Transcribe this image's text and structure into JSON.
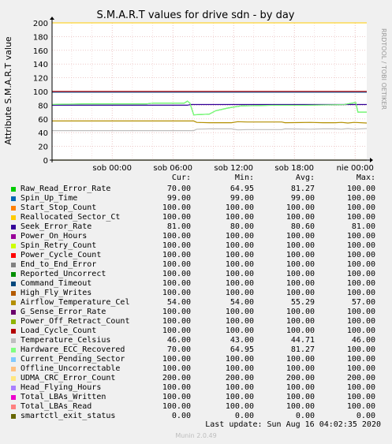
{
  "chart_data": {
    "type": "line",
    "title": "S.M.A.R.T values for drive sdn - by day",
    "ylabel": "Attribute S.M.A.R.T value",
    "side_label": "RRDTOOL / TOBI OETIKER",
    "ylim": [
      0,
      200
    ],
    "y_ticks": [
      "0",
      "20",
      "40",
      "60",
      "80",
      "100",
      "120",
      "140",
      "160",
      "180",
      "200"
    ],
    "x_ticks": [
      {
        "label": "sob 00:00",
        "t": 0.191
      },
      {
        "label": "sob 06:00",
        "t": 0.384
      },
      {
        "label": "sob 12:00",
        "t": 0.577
      },
      {
        "label": "sob 18:00",
        "t": 0.77
      },
      {
        "label": "nie 00:00",
        "t": 0.963
      }
    ],
    "columns": [
      "Cur:",
      "Min:",
      "Avg:",
      "Max:"
    ],
    "series": [
      {
        "name": "Raw_Read_Error_Rate",
        "color": "#00cc00",
        "cur": "70.00",
        "min": "64.95",
        "avg": "81.27",
        "max": "100.00"
      },
      {
        "name": "Spin_Up_Time",
        "color": "#0066b3",
        "cur": "99.00",
        "min": "99.00",
        "avg": "99.00",
        "max": "100.00"
      },
      {
        "name": "Start_Stop_Count",
        "color": "#ff8000",
        "cur": "100.00",
        "min": "100.00",
        "avg": "100.00",
        "max": "100.00"
      },
      {
        "name": "Reallocated_Sector_Ct",
        "color": "#ffcc00",
        "cur": "100.00",
        "min": "100.00",
        "avg": "100.00",
        "max": "100.00"
      },
      {
        "name": "Seek_Error_Rate",
        "color": "#330099",
        "cur": "81.00",
        "min": "80.00",
        "avg": "80.60",
        "max": "81.00"
      },
      {
        "name": "Power_On_Hours",
        "color": "#990099",
        "cur": "100.00",
        "min": "100.00",
        "avg": "100.00",
        "max": "100.00"
      },
      {
        "name": "Spin_Retry_Count",
        "color": "#ccff00",
        "cur": "100.00",
        "min": "100.00",
        "avg": "100.00",
        "max": "100.00"
      },
      {
        "name": "Power_Cycle_Count",
        "color": "#ff0000",
        "cur": "100.00",
        "min": "100.00",
        "avg": "100.00",
        "max": "100.00"
      },
      {
        "name": "End_to_End_Error",
        "color": "#808080",
        "cur": "100.00",
        "min": "100.00",
        "avg": "100.00",
        "max": "100.00"
      },
      {
        "name": "Reported_Uncorrect",
        "color": "#008f00",
        "cur": "100.00",
        "min": "100.00",
        "avg": "100.00",
        "max": "100.00"
      },
      {
        "name": "Command_Timeout",
        "color": "#00487d",
        "cur": "100.00",
        "min": "100.00",
        "avg": "100.00",
        "max": "100.00"
      },
      {
        "name": "High_Fly_Writes",
        "color": "#b35a00",
        "cur": "100.00",
        "min": "100.00",
        "avg": "100.00",
        "max": "100.00"
      },
      {
        "name": "Airflow_Temperature_Cel",
        "color": "#b38f00",
        "cur": "54.00",
        "min": "54.00",
        "avg": "55.29",
        "max": "57.00"
      },
      {
        "name": "G_Sense_Error_Rate",
        "color": "#6b006b",
        "cur": "100.00",
        "min": "100.00",
        "avg": "100.00",
        "max": "100.00"
      },
      {
        "name": "Power_Off_Retract_Count",
        "color": "#8fb300",
        "cur": "100.00",
        "min": "100.00",
        "avg": "100.00",
        "max": "100.00"
      },
      {
        "name": "Load_Cycle_Count",
        "color": "#b30000",
        "cur": "100.00",
        "min": "100.00",
        "avg": "100.00",
        "max": "100.00"
      },
      {
        "name": "Temperature_Celsius",
        "color": "#bebebe",
        "cur": "46.00",
        "min": "43.00",
        "avg": "44.71",
        "max": "46.00"
      },
      {
        "name": "Hardware_ECC_Recovered",
        "color": "#80ff80",
        "cur": "70.00",
        "min": "64.95",
        "avg": "81.27",
        "max": "100.00"
      },
      {
        "name": "Current_Pending_Sector",
        "color": "#80c9ff",
        "cur": "100.00",
        "min": "100.00",
        "avg": "100.00",
        "max": "100.00"
      },
      {
        "name": "Offline_Uncorrectable",
        "color": "#ffc080",
        "cur": "100.00",
        "min": "100.00",
        "avg": "100.00",
        "max": "100.00"
      },
      {
        "name": "UDMA_CRC_Error_Count",
        "color": "#ffe680",
        "cur": "200.00",
        "min": "200.00",
        "avg": "200.00",
        "max": "200.00"
      },
      {
        "name": "Head_Flying_Hours",
        "color": "#aa80ff",
        "cur": "100.00",
        "min": "100.00",
        "avg": "100.00",
        "max": "100.00"
      },
      {
        "name": "Total_LBAs_Written",
        "color": "#ee00cc",
        "cur": "100.00",
        "min": "100.00",
        "avg": "100.00",
        "max": "100.00"
      },
      {
        "name": "Total_LBAs_Read",
        "color": "#ff8080",
        "cur": "100.00",
        "min": "100.00",
        "avg": "100.00",
        "max": "100.00"
      },
      {
        "name": "smartctl_exit_status",
        "color": "#666600",
        "cur": "0.00",
        "min": "0.00",
        "avg": "0.00",
        "max": "0.00"
      }
    ],
    "lines": [
      {
        "name": "Raw_Read_Error_Rate",
        "color": "#00cc00",
        "points": [
          [
            0,
            81
          ],
          [
            0.05,
            81.5
          ],
          [
            0.1,
            82
          ],
          [
            0.3,
            82
          ],
          [
            0.32,
            83
          ],
          [
            0.42,
            83
          ],
          [
            0.43,
            86
          ],
          [
            0.438,
            83
          ],
          [
            0.45,
            66
          ],
          [
            0.5,
            67
          ],
          [
            0.52,
            72
          ],
          [
            0.56,
            76
          ],
          [
            0.6,
            79
          ],
          [
            0.7,
            80
          ],
          [
            0.8,
            80
          ],
          [
            0.93,
            81
          ],
          [
            0.965,
            84
          ],
          [
            0.972,
            70
          ],
          [
            1,
            70
          ]
        ]
      },
      {
        "name": "Spin_Up_Time",
        "color": "#0066b3",
        "points": [
          [
            0,
            99
          ],
          [
            1,
            99
          ]
        ]
      },
      {
        "name": "Seek_Error_Rate",
        "color": "#330099",
        "points": [
          [
            0,
            80
          ],
          [
            0.43,
            80
          ],
          [
            0.44,
            81
          ],
          [
            1,
            81
          ]
        ]
      },
      {
        "name": "Load_Cycle_Count",
        "color": "#b30000",
        "points": [
          [
            0,
            100
          ],
          [
            1,
            100
          ]
        ]
      },
      {
        "name": "Airflow_Temperature_Cel",
        "color": "#b38f00",
        "points": [
          [
            0,
            57
          ],
          [
            0.45,
            57
          ],
          [
            0.46,
            55
          ],
          [
            0.5,
            54.5
          ],
          [
            0.57,
            54.5
          ],
          [
            0.59,
            56
          ],
          [
            0.62,
            55.5
          ],
          [
            0.73,
            55.5
          ],
          [
            0.74,
            54.5
          ],
          [
            0.82,
            55
          ],
          [
            0.86,
            54.5
          ],
          [
            0.9,
            54.5
          ],
          [
            0.92,
            55
          ],
          [
            0.94,
            54
          ],
          [
            0.96,
            55
          ],
          [
            1,
            54
          ]
        ]
      },
      {
        "name": "Temperature_Celsius",
        "color": "#bebebe",
        "points": [
          [
            0,
            43
          ],
          [
            0.45,
            43
          ],
          [
            0.46,
            45
          ],
          [
            0.5,
            45.5
          ],
          [
            0.57,
            45.5
          ],
          [
            0.59,
            44
          ],
          [
            0.62,
            44.5
          ],
          [
            0.73,
            44.5
          ],
          [
            0.74,
            45.5
          ],
          [
            0.82,
            45
          ],
          [
            0.86,
            45.5
          ],
          [
            0.9,
            45.5
          ],
          [
            0.92,
            45
          ],
          [
            0.94,
            46
          ],
          [
            0.96,
            45
          ],
          [
            1,
            46
          ]
        ]
      },
      {
        "name": "smartctl_exit_status",
        "color": "#666600",
        "points": [
          [
            0,
            0
          ],
          [
            1,
            0
          ]
        ]
      }
    ]
  },
  "footer": {
    "last_update": "Last update: Sun Aug 16 04:02:35 2020",
    "munin": "Munin 2.0.49"
  }
}
